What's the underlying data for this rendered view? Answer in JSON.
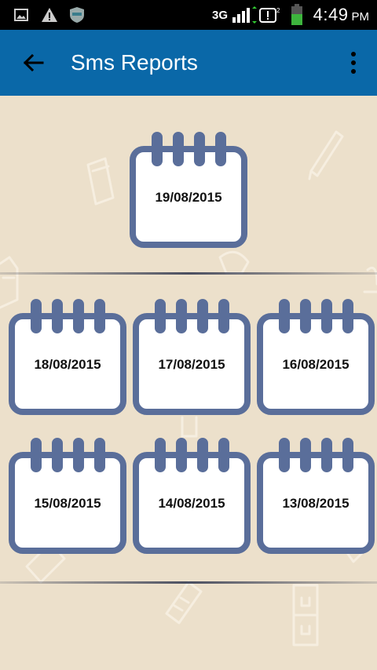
{
  "status_bar": {
    "network": "3G",
    "time": "4:49",
    "ampm": "PM",
    "icons": [
      "image-icon",
      "warning-icon",
      "shield-icon",
      "signal-icon",
      "notification-icon",
      "battery-icon"
    ]
  },
  "app_bar": {
    "title": "Sms Reports",
    "back_icon": "arrow-back-icon",
    "menu_icon": "more-vert-icon",
    "color": "#0a68a8"
  },
  "reports": {
    "featured": "19/08/2015",
    "row1": [
      "18/08/2015",
      "17/08/2015",
      "16/08/2015"
    ],
    "row2": [
      "15/08/2015",
      "14/08/2015",
      "13/08/2015"
    ]
  },
  "colors": {
    "background": "#ece0cb",
    "calendar_frame": "#5a6e9a",
    "calendar_fill": "#ffffff"
  }
}
